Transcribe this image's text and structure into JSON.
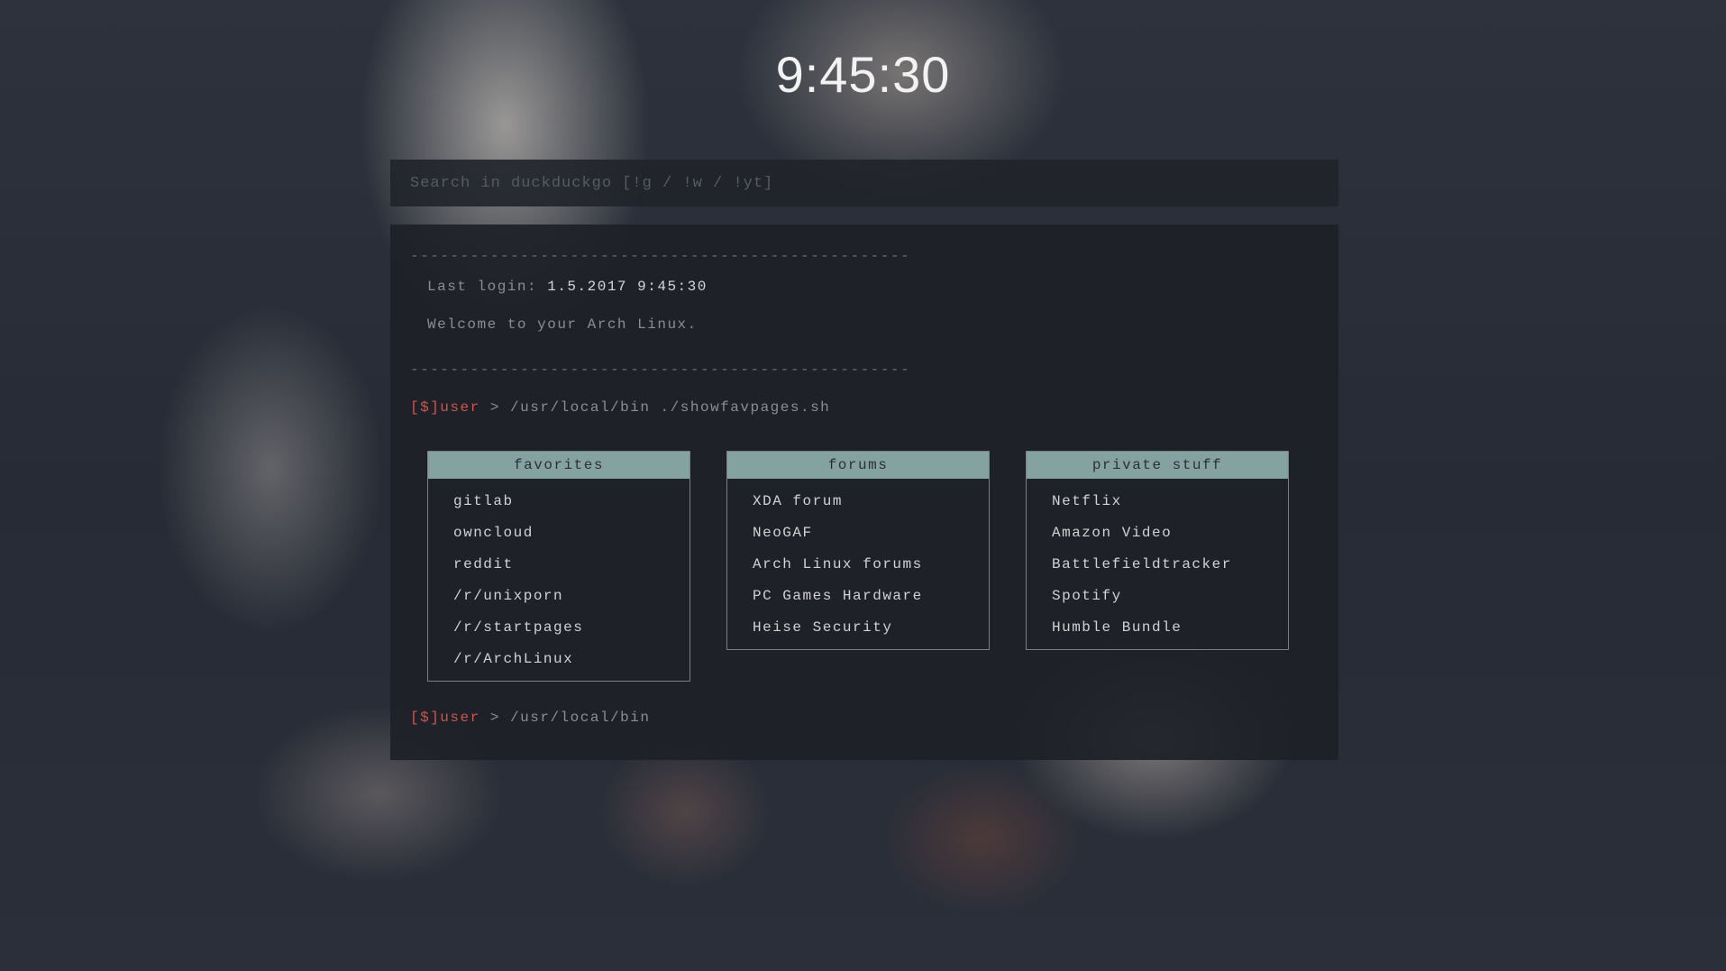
{
  "clock": {
    "time": "9:45:30"
  },
  "search": {
    "placeholder": "Search in duckduckgo [!g / !w / !yt]"
  },
  "terminal": {
    "divider": "--------------------------------------------------",
    "last_login_label": "Last login: ",
    "last_login_value": "1.5.2017 9:45:30",
    "welcome": "Welcome to your Arch Linux.",
    "prompt_user": "[$]user",
    "prompt_arrow": " > ",
    "command_line": "/usr/local/bin ./showfavpages.sh",
    "final_path": "/usr/local/bin"
  },
  "panels": [
    {
      "title": "favorites",
      "links": [
        "gitlab",
        "owncloud",
        "reddit",
        "/r/unixporn",
        "/r/startpages",
        "/r/ArchLinux"
      ]
    },
    {
      "title": "forums",
      "links": [
        "XDA forum",
        "NeoGAF",
        "Arch Linux forums",
        "PC Games Hardware",
        "Heise Security"
      ]
    },
    {
      "title": "private stuff",
      "links": [
        "Netflix",
        "Amazon Video",
        "Battlefieldtracker",
        "Spotify",
        "Humble Bundle"
      ]
    }
  ],
  "colors": {
    "accent_header": "#85a2a3",
    "prompt_red": "#c9574e",
    "panel_bg": "#1e2128"
  }
}
